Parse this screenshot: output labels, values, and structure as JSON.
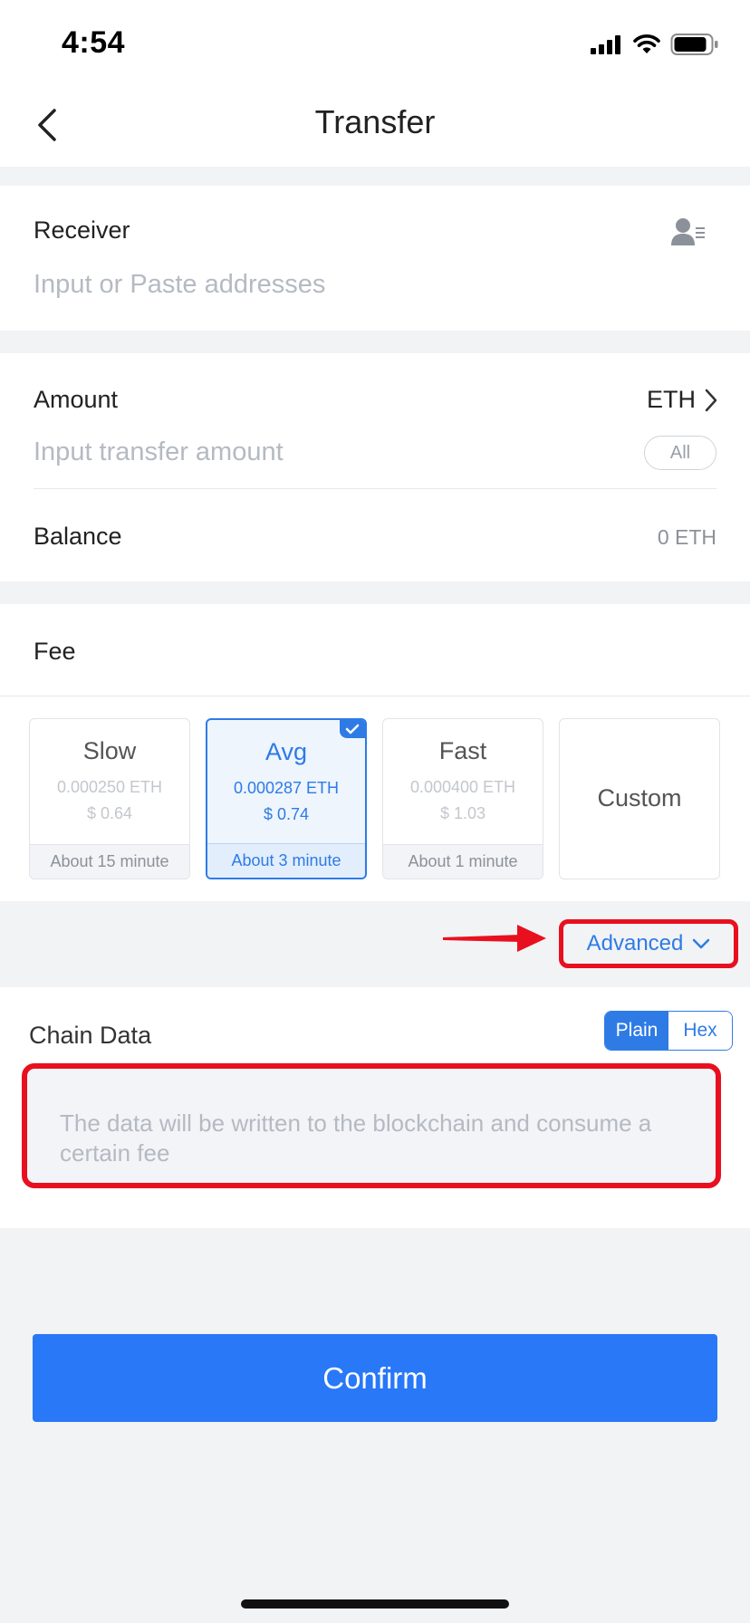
{
  "status_bar": {
    "time": "4:54",
    "icons": [
      "signal-icon",
      "wifi-icon",
      "battery-icon"
    ]
  },
  "nav": {
    "title": "Transfer",
    "back_icon": "chevron-left-icon"
  },
  "receiver": {
    "label": "Receiver",
    "placeholder": "Input or Paste addresses",
    "icon": "contact-list-icon"
  },
  "amount": {
    "label": "Amount",
    "token": "ETH",
    "placeholder": "Input transfer amount",
    "all_label": "All"
  },
  "balance": {
    "label": "Balance",
    "value": "0 ETH"
  },
  "fee": {
    "label": "Fee",
    "options": [
      {
        "name": "Slow",
        "eth": "0.000250 ETH",
        "usd": "$ 0.64",
        "time": "About 15 minute",
        "selected": false
      },
      {
        "name": "Avg",
        "eth": "0.000287 ETH",
        "usd": "$ 0.74",
        "time": "About 3 minute",
        "selected": true
      },
      {
        "name": "Fast",
        "eth": "0.000400 ETH",
        "usd": "$ 1.03",
        "time": "About 1 minute",
        "selected": false
      },
      {
        "name": "Custom"
      }
    ]
  },
  "advanced": {
    "label": "Advanced"
  },
  "chain_data": {
    "label": "Chain Data",
    "modes": [
      "Plain",
      "Hex"
    ],
    "active_mode": "Plain",
    "placeholder": "The data will be written to the blockchain and consume a certain fee"
  },
  "confirm": {
    "label": "Confirm"
  },
  "colors": {
    "accent": "#2E7BE6",
    "button": "#2878F8",
    "annotation": "#E8101F"
  }
}
